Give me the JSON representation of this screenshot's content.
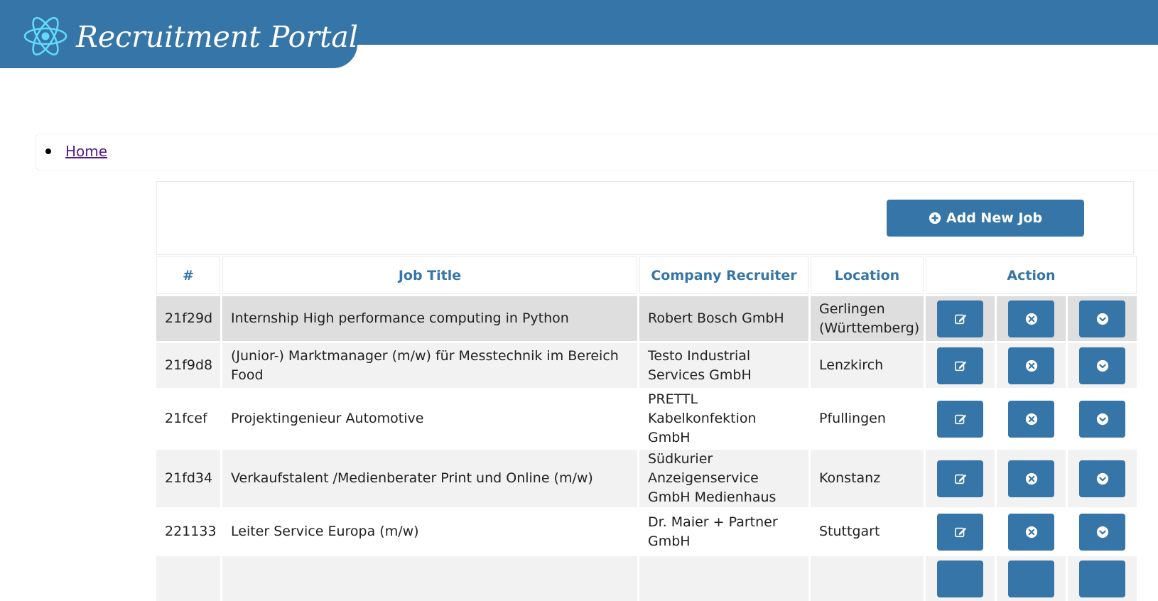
{
  "header": {
    "app_title": "Recruitment Portal",
    "logo_icon": "react-atom-icon",
    "brand_color": "#3675a7"
  },
  "breadcrumb": {
    "items": [
      {
        "label": "Home"
      }
    ]
  },
  "toolbar": {
    "add_job_label": "Add New Job",
    "add_job_icon": "plus-circle-icon"
  },
  "table": {
    "columns": [
      "#",
      "Job Title",
      "Company Recruiter",
      "Location",
      "Action"
    ],
    "rows": [
      {
        "id": "21f29d",
        "title": "Internship High performance computing in Python",
        "company": "Robert Bosch GmbH",
        "location": "Gerlingen (Württemberg)"
      },
      {
        "id": "21f9d8",
        "title": "(Junior-) Marktmanager (m/w) für Messtechnik im Bereich Food",
        "company": "Testo Industrial Services GmbH",
        "location": "Lenzkirch"
      },
      {
        "id": "21fcef",
        "title": "Projektingenieur Automotive",
        "company": "PRETTL Kabelkonfektion GmbH",
        "location": "Pfullingen"
      },
      {
        "id": "21fd34",
        "title": "Verkaufstalent /Medienberater Print und Online (m/w)",
        "company": "Südkurier Anzeigenservice GmbH Medienhaus",
        "location": "Konstanz"
      },
      {
        "id": "221133",
        "title": "Leiter Service Europa (m/w)",
        "company": "Dr. Maier + Partner GmbH",
        "location": "Stuttgart"
      }
    ],
    "action_icons": [
      "edit-icon",
      "delete-icon",
      "expand-icon"
    ]
  }
}
